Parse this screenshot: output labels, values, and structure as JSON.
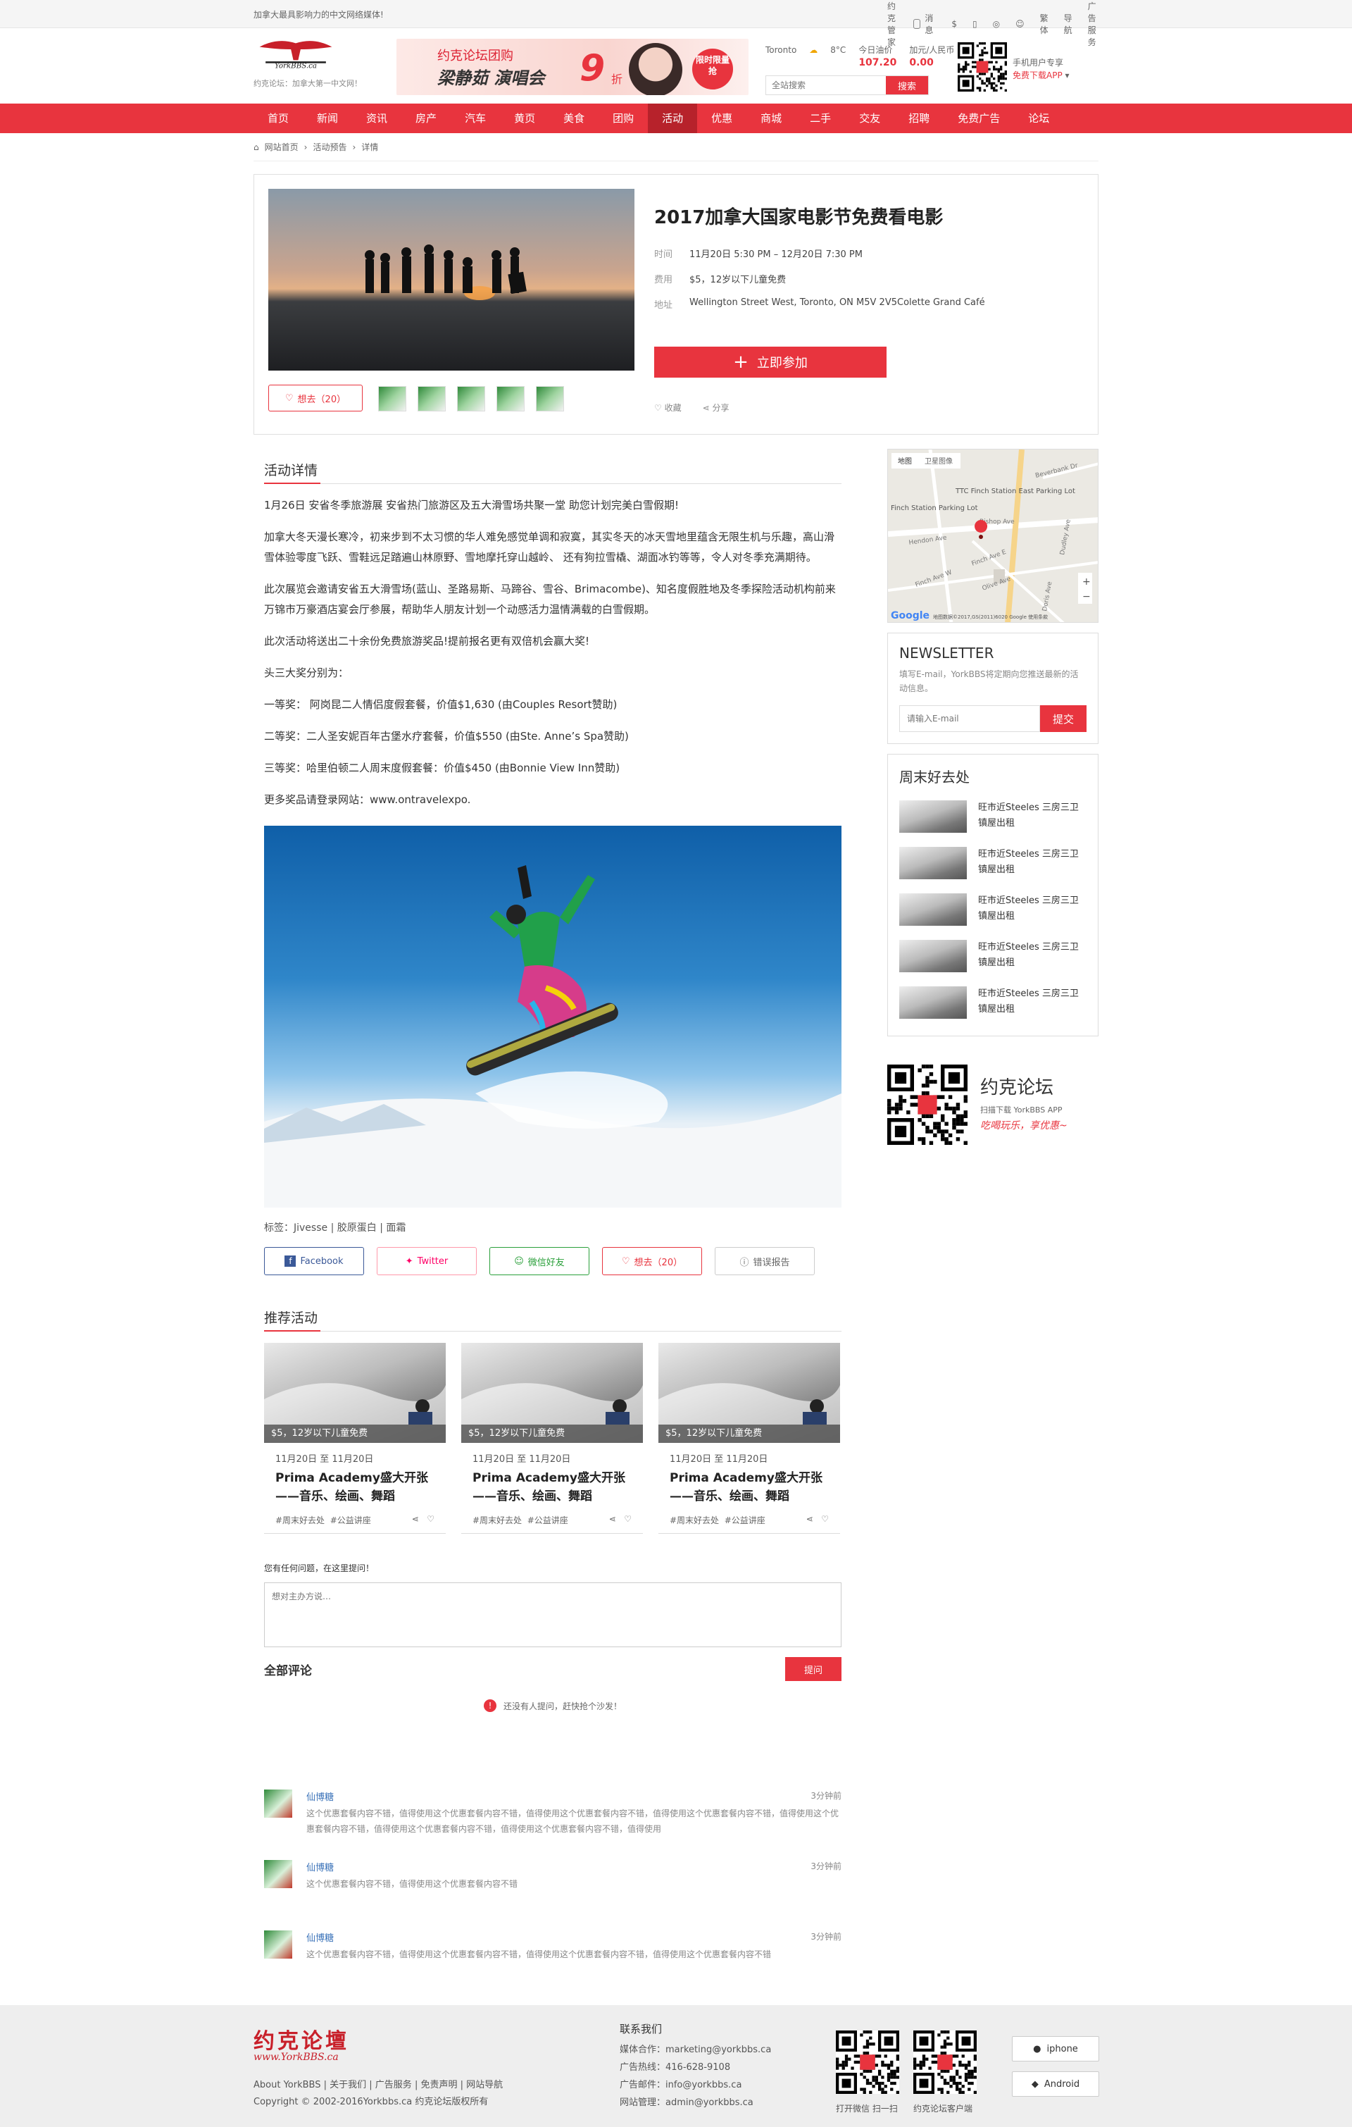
{
  "topbar": {
    "slogan": "加拿大最具影响力的中文网络媒体!",
    "links": [
      "约克管家",
      "消息",
      "繁体",
      "导航",
      "广告服务"
    ]
  },
  "header": {
    "logo_text": "YorkBBS.ca",
    "logo_sub": "约克论坛：加拿大第一中文网！",
    "banner": {
      "line1": "约克论坛团购",
      "line2": "梁静茹 演唱会",
      "discount": "9",
      "unit": "折",
      "badge": "限时限量\n抢"
    },
    "weather": {
      "city": "Toronto",
      "temp": "8°C",
      "oil_label": "今日油价",
      "oil_value": "107.20",
      "fx_label": "加元/人民币",
      "fx_value": "0.00"
    },
    "search_placeholder": "全站搜索",
    "search_button": "搜索",
    "app_line1": "手机用户专享",
    "app_line2": "免费下载APP"
  },
  "nav": {
    "items": [
      "首页",
      "新闻",
      "资讯",
      "房产",
      "汽车",
      "黄页",
      "美食",
      "团购",
      "活动",
      "优惠",
      "商城",
      "二手",
      "交友",
      "招聘",
      "免费广告",
      "论坛"
    ],
    "active_index": 8
  },
  "breadcrumb": [
    "网站首页",
    "活动预告",
    "详情"
  ],
  "event": {
    "title": "2017加拿大国家电影节免费看电影",
    "time_label": "时间",
    "time": "11月20日 5:30 PM – 12月20日 7:30 PM",
    "fee_label": "费用",
    "fee": "$5，12岁以下儿童免费",
    "addr_label": "地址",
    "addr": "Wellington Street West, Toronto, ON M5V 2V5Colette Grand Café",
    "join_button": "立即参加",
    "want": "想去（20）",
    "collect": "收藏",
    "share": "分享"
  },
  "detail": {
    "heading": "活动详情",
    "paragraphs": [
      "1月26日 安省冬季旅游展 安省热门旅游区及五大滑雪场共聚一堂 助您计划完美白雪假期!",
      "加拿大冬天漫长寒冷，初来步到不太习惯的华人难免感觉单调和寂寞，其实冬天的冰天雪地里蕴含无限生机与乐趣，高山滑雪体验零度飞跃、雪鞋远足踏遍山林原野、雪地摩托穿山越岭、 还有狗拉雪橇、湖面冰钓等等，令人对冬季充满期待。",
      "此次展览会邀请安省五大滑雪场(蓝山、圣路易斯、马蹄谷、雪谷、Brimacombe)、知名度假胜地及冬季探险活动机构前来万锦市万豪酒店宴会厅参展，帮助华人朋友计划一个动感活力温情满载的白雪假期。",
      "此次活动将送出二十余份免费旅游奖品!提前报名更有双倍机会赢大奖!",
      "头三大奖分别为：",
      "一等奖： 阿岗昆二人情侣度假套餐，价值$1,630 (由Couples Resort赞助)",
      "二等奖：二人圣安妮百年古堡水疗套餐，价值$550 (由Ste. Anne’s Spa赞助)",
      "三等奖：哈里伯顿二人周末度假套餐：价值$450 (由Bonnie View Inn赞助)",
      "更多奖品请登录网站：www.ontravelexpo."
    ],
    "tags_label": "标签：",
    "tags": [
      "Jivesse",
      "胶原蛋白",
      "面霜"
    ],
    "share_buttons": [
      "Facebook",
      "Twitter",
      "微信好友",
      "想去（20）",
      "错误报告"
    ]
  },
  "recommend": {
    "heading": "推荐活动",
    "cards": [
      {
        "price": "$5，12岁以下儿童免费",
        "date": "11月20日 至 11月20日",
        "title": "Prima Academy盛大开张——音乐、绘画、舞蹈",
        "tags": [
          "#周末好去处",
          "#公益讲座"
        ]
      },
      {
        "price": "$5，12岁以下儿童免费",
        "date": "11月20日 至 11月20日",
        "title": "Prima Academy盛大开张——音乐、绘画、舞蹈",
        "tags": [
          "#周末好去处",
          "#公益讲座"
        ]
      },
      {
        "price": "$5，12岁以下儿童免费",
        "date": "11月20日 至 11月20日",
        "title": "Prima Academy盛大开张——音乐、绘画、舞蹈",
        "tags": [
          "#周末好去处",
          "#公益讲座"
        ]
      }
    ]
  },
  "qa": {
    "prompt": "您有任何问题，在这里提问！",
    "placeholder": "想对主办方说…",
    "all_comments": "全部评论",
    "ask_button": "提问",
    "empty": "还没有人提问，赶快抢个沙发！"
  },
  "comments": [
    {
      "name": "仙博糖",
      "time": "3分钟前",
      "text": "这个优惠套餐内容不错，值得使用这个优惠套餐内容不错，值得使用这个优惠套餐内容不错，值得使用这个优惠套餐内容不错，值得使用这个优惠套餐内容不错，值得使用这个优惠套餐内容不错，值得使用这个优惠套餐内容不错，值得使用"
    },
    {
      "name": "仙博糖",
      "time": "3分钟前",
      "text": "这个优惠套餐内容不错，值得使用这个优惠套餐内容不错"
    },
    {
      "name": "仙博糖",
      "time": "3分钟前",
      "text": "这个优惠套餐内容不错，值得使用这个优惠套餐内容不错，值得使用这个优惠套餐内容不错，值得使用这个优惠套餐内容不错"
    }
  ],
  "sidebar": {
    "map": {
      "tab_map": "地图",
      "tab_sat": "卫星图像",
      "label1": "TTC Finch Station East Parking Lot",
      "label2": "Finch Station Parking Lot",
      "streets": [
        "Hendon Ave",
        "Finch Ave W",
        "Bishop Ave",
        "Finch Ave E",
        "Olive Ave",
        "Doris Ave",
        "Dudley Ave",
        "Beverbank Dr"
      ],
      "google": "Google",
      "copyright": "地图数据©2017,GS(2011)6020 Google  使用条款"
    },
    "newsletter": {
      "title": "NEWSLETTER",
      "desc": "填写E-mail，YorkBBS将定期向您推送最新的活动信息。",
      "placeholder": "请输入E-mail",
      "button": "提交"
    },
    "weekend": {
      "title": "周末好去处",
      "items": [
        "旺市近Steeles 三房三卫镇屋出租",
        "旺市近Steeles 三房三卫镇屋出租",
        "旺市近Steeles 三房三卫镇屋出租",
        "旺市近Steeles 三房三卫镇屋出租",
        "旺市近Steeles 三房三卫镇屋出租"
      ]
    },
    "app": {
      "name": "约克论坛",
      "sub": "扫描下载 YorkBBS APP",
      "slogan": "吃喝玩乐，享优惠~"
    }
  },
  "footer": {
    "logo": "约克论壇",
    "logo_sub": "www.YorkBBS.ca",
    "links": [
      "About YorkBBS",
      "关于我们",
      "广告服务",
      "免责声明",
      "网站导航"
    ],
    "copyright": "Copyright © 2002-2016Yorkbbs.ca 约克论坛版权所有",
    "contact_title": "联系我们",
    "contacts": [
      "媒体合作：marketing@yorkbbs.ca",
      "广告热线：416-628-9108",
      "广告邮件：info@yorkbbs.ca",
      "网站管理：admin@yorkbbs.ca"
    ],
    "qr1": "打开微信 扫一扫",
    "qr2": "约克论坛客户端",
    "btn_iphone": "iphone",
    "btn_android": "Android"
  },
  "colors": {
    "brand": "#e8343e",
    "brand_dark": "#b7222b"
  }
}
